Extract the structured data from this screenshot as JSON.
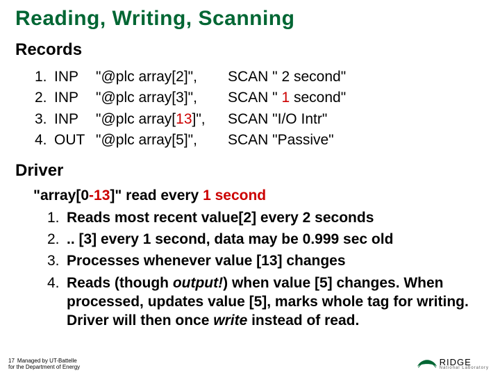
{
  "title": "Reading, Writing, Scanning",
  "records": {
    "heading": "Records",
    "items": [
      {
        "n": "1.",
        "dir": "INP",
        "addr_pre": "\"@plc array[",
        "addr_idx": "2",
        "addr_idx_red": false,
        "addr_post": "]\",",
        "scan_pre": "SCAN \"",
        "scan_mid": " 2",
        "scan_mid_red": false,
        "scan_post": " second\""
      },
      {
        "n": "2.",
        "dir": "INP",
        "addr_pre": "\"@plc array[",
        "addr_idx": "3",
        "addr_idx_red": false,
        "addr_post": "]\",",
        "scan_pre": "SCAN \"",
        "scan_mid": " 1",
        "scan_mid_red": true,
        "scan_post": " second\""
      },
      {
        "n": "3.",
        "dir": "INP",
        "addr_pre": "\"@plc array[",
        "addr_idx": "13",
        "addr_idx_red": true,
        "addr_post": "]\",",
        "scan_pre": "SCAN \"",
        "scan_mid": "I/O Intr",
        "scan_mid_red": false,
        "scan_post": "\""
      },
      {
        "n": "4.",
        "dir": "OUT",
        "addr_pre": "\"@plc array[",
        "addr_idx": "5",
        "addr_idx_red": false,
        "addr_post": "]\",",
        "scan_pre": "SCAN \"",
        "scan_mid": "Passive",
        "scan_mid_red": false,
        "scan_post": "\""
      }
    ]
  },
  "driver": {
    "heading": "Driver",
    "intro_pre": "\"array[0",
    "intro_red1": "-13",
    "intro_mid": "]\" read every ",
    "intro_red2": "1 second",
    "items": [
      {
        "n": "1.",
        "text": "Reads most recent value[2] every 2 seconds"
      },
      {
        "n": "2.",
        "text": ".. [3] every 1 second, data may be 0.999 sec old"
      },
      {
        "n": "3.",
        "text": "Processes whenever value [13] changes"
      },
      {
        "n": "4.",
        "pre": "Reads (though ",
        "ital": "output!",
        "mid": ") when value [5] changes. When processed, updates value [5], marks whole tag for writing. Driver will then once ",
        "ital2": "write",
        "post": " instead of read."
      }
    ]
  },
  "footer": {
    "pagenum": "17",
    "line1": "Managed by UT-Battelle",
    "line2": "for the Department of Energy"
  },
  "logo": {
    "ridge": "RIDGE",
    "nl": "National Laboratory"
  }
}
